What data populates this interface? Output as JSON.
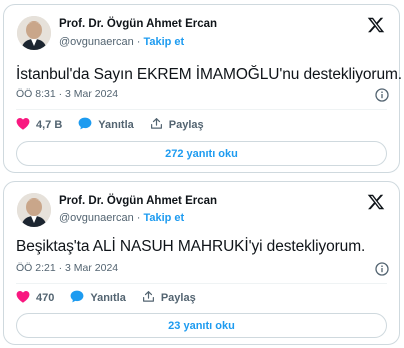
{
  "tweets": [
    {
      "author_name": "Prof. Dr. Övgün Ahmet Ercan",
      "handle": "@ovgunaercan",
      "separator": "·",
      "follow_label": "Takip et",
      "text": "İstanbul'da Sayın EKREM İMAMOĞLU'nu destekliyorum.",
      "timestamp": "ÖÖ 8:31 · 3 Mar 2024",
      "likes": "4,7 B",
      "reply_label": "Yanıtla",
      "share_label": "Paylaş",
      "replies_button": "272 yanıtı oku"
    },
    {
      "author_name": "Prof. Dr. Övgün Ahmet Ercan",
      "handle": "@ovgunaercan",
      "separator": "·",
      "follow_label": "Takip et",
      "text": "Beşiktaş'ta ALİ NASUH MAHRUKİ'yi destekliyorum.",
      "timestamp": "ÖÖ 2:21 · 3 Mar 2024",
      "likes": "470",
      "reply_label": "Yanıtla",
      "share_label": "Paylaş",
      "replies_button": "23 yanıtı oku"
    }
  ],
  "icons": {
    "brand": "x-logo-icon",
    "info": "info-icon",
    "like": "heart-icon",
    "reply": "speech-bubble-icon",
    "share": "share-upload-icon"
  },
  "colors": {
    "accent": "#1d9bf0",
    "like": "#f91880",
    "text": "#0f1419",
    "muted": "#536471",
    "border": "#cfd9de"
  }
}
